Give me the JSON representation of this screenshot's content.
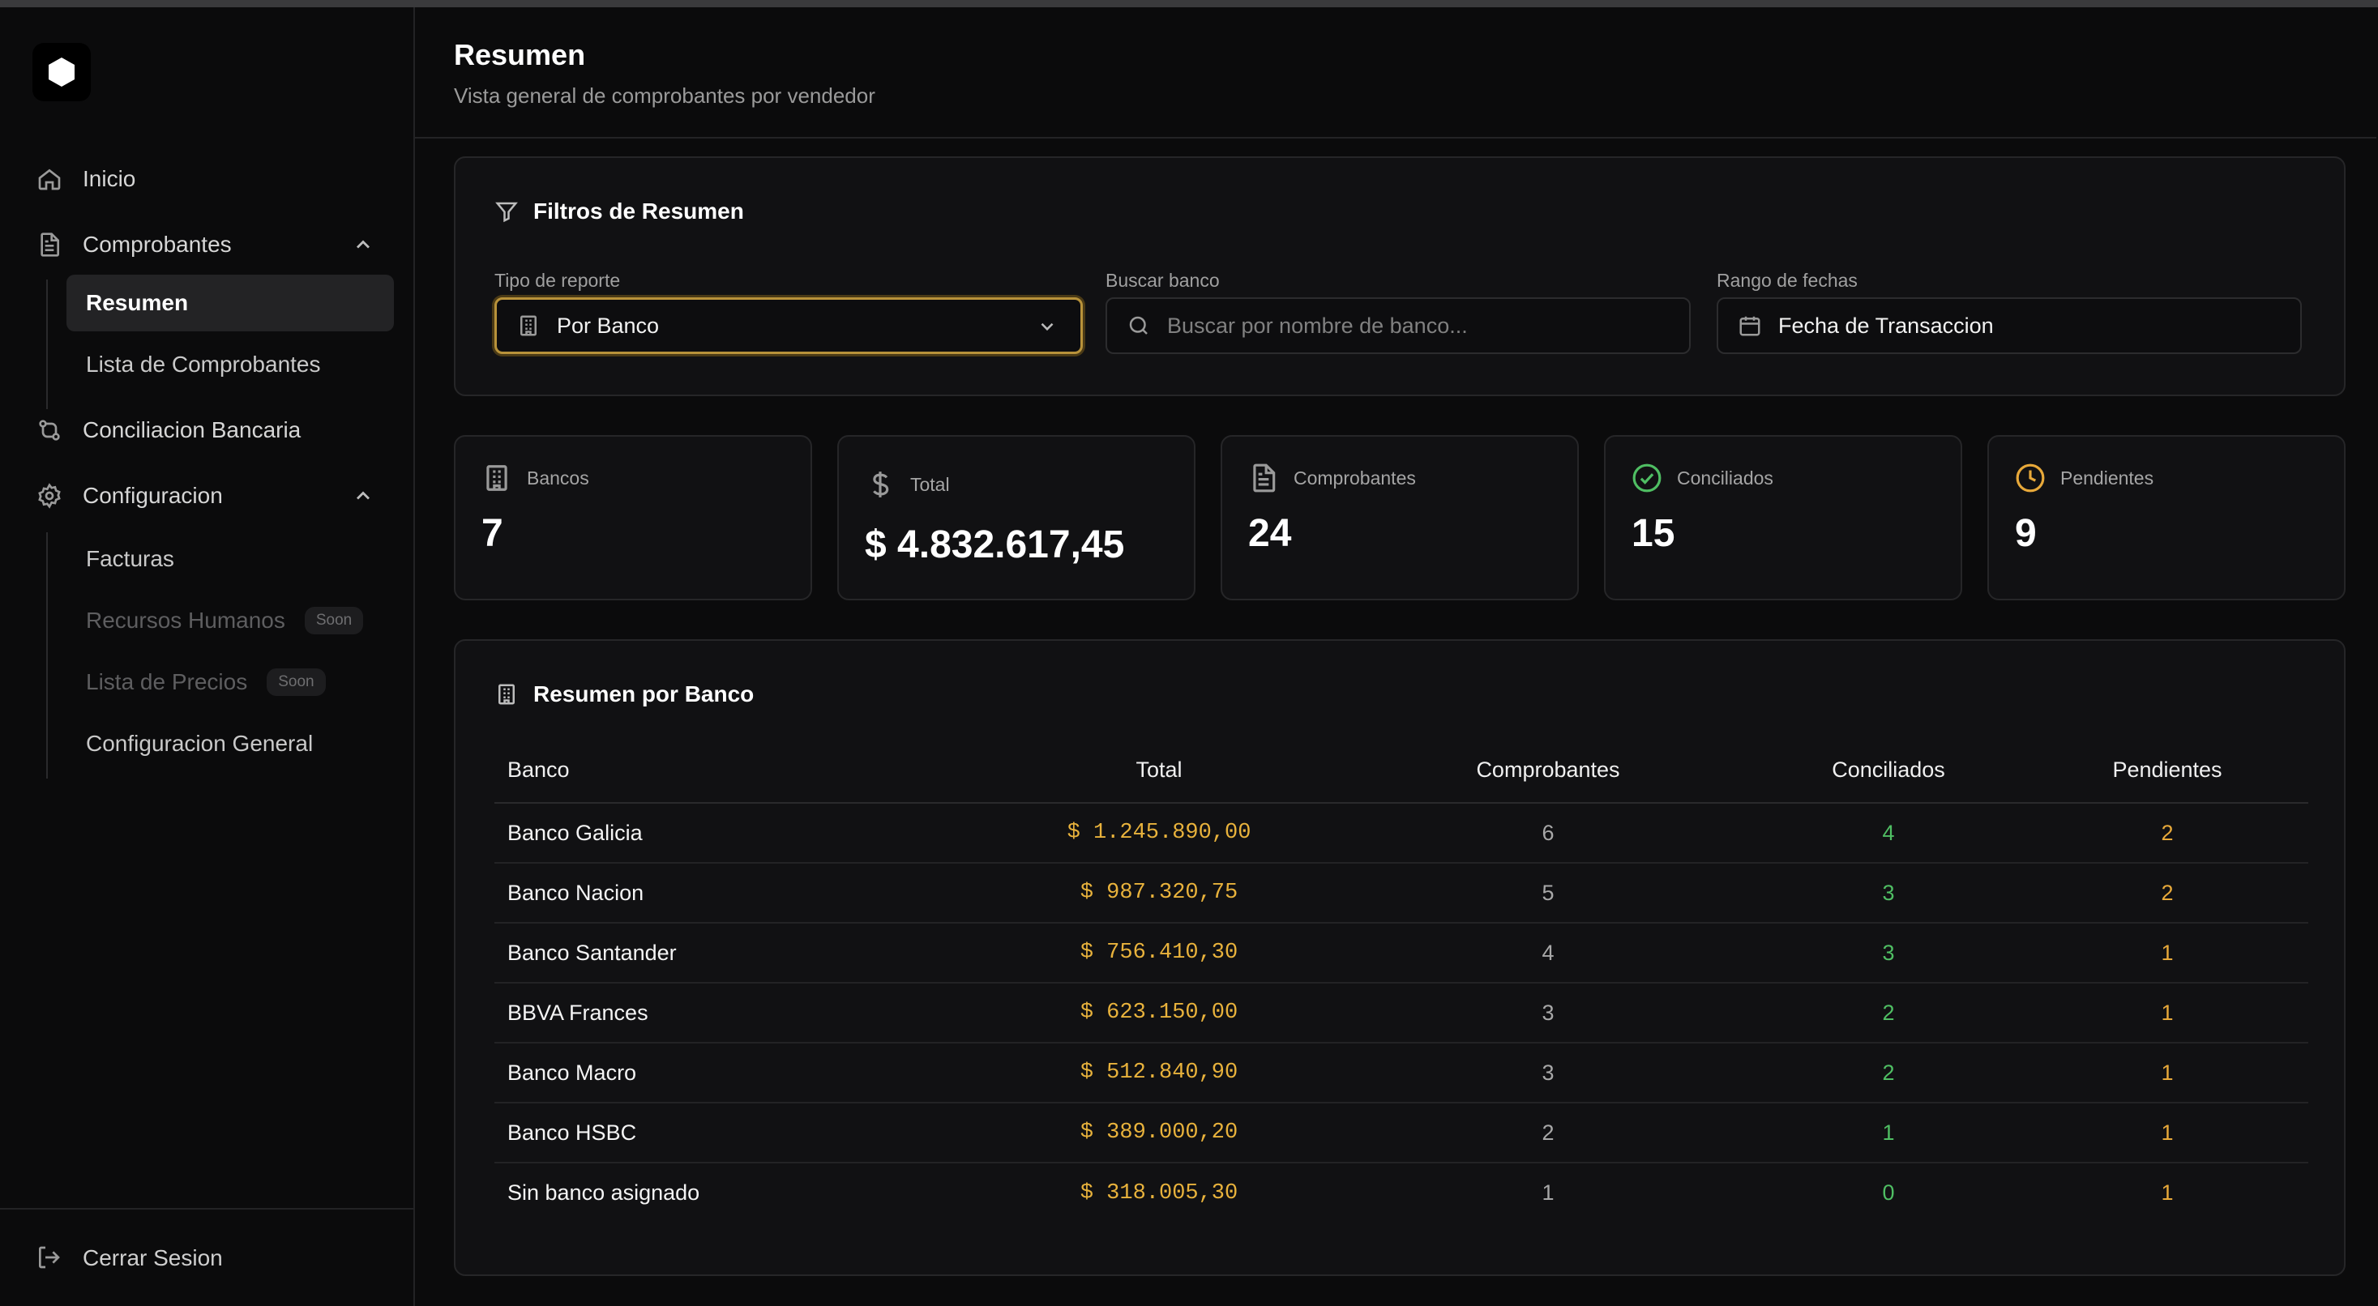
{
  "colors": {
    "accent": "#e8b23c",
    "success": "#4fbe63",
    "warning": "#e8a93a",
    "background": "#0b0b0c"
  },
  "sidebar": {
    "logo_icon": "hexagon-logo-icon",
    "items": [
      {
        "label": "Inicio",
        "icon": "home-icon"
      },
      {
        "label": "Comprobantes",
        "icon": "document-icon",
        "expanded": true,
        "children": [
          {
            "label": "Resumen",
            "active": true
          },
          {
            "label": "Lista de Comprobantes"
          }
        ]
      },
      {
        "label": "Conciliacion Bancaria",
        "icon": "git-compare-icon"
      },
      {
        "label": "Configuracion",
        "icon": "gear-icon",
        "expanded": true,
        "children": [
          {
            "label": "Facturas"
          },
          {
            "label": "Recursos Humanos",
            "badge": "Soon",
            "disabled": true
          },
          {
            "label": "Lista de Precios",
            "badge": "Soon",
            "disabled": true
          },
          {
            "label": "Configuracion General"
          }
        ]
      }
    ],
    "logout_label": "Cerrar Sesion"
  },
  "header": {
    "title": "Resumen",
    "subtitle": "Vista general de comprobantes por vendedor"
  },
  "filters": {
    "title": "Filtros de Resumen",
    "report_type": {
      "label": "Tipo de reporte",
      "value": "Por Banco"
    },
    "bank_search": {
      "label": "Buscar banco",
      "placeholder": "Buscar por nombre de banco..."
    },
    "date_range": {
      "label": "Rango de fechas",
      "value": "Fecha de Transaccion"
    }
  },
  "stats": [
    {
      "label": "Bancos",
      "value": "7",
      "icon": "building-icon"
    },
    {
      "label": "Total",
      "value": "$ 4.832.617,45",
      "icon": "dollar-icon"
    },
    {
      "label": "Comprobantes",
      "value": "24",
      "icon": "document-icon"
    },
    {
      "label": "Conciliados",
      "value": "15",
      "icon": "check-circle-icon"
    },
    {
      "label": "Pendientes",
      "value": "9",
      "icon": "clock-icon"
    }
  ],
  "table": {
    "title": "Resumen por Banco",
    "columns": [
      "Banco",
      "Total",
      "Comprobantes",
      "Conciliados",
      "Pendientes"
    ],
    "rows": [
      {
        "bank": "Banco Galicia",
        "total": "$ 1.245.890,00",
        "comprobantes": "6",
        "conciliados": "4",
        "pendientes": "2"
      },
      {
        "bank": "Banco Nacion",
        "total": "$ 987.320,75",
        "comprobantes": "5",
        "conciliados": "3",
        "pendientes": "2"
      },
      {
        "bank": "Banco Santander",
        "total": "$ 756.410,30",
        "comprobantes": "4",
        "conciliados": "3",
        "pendientes": "1"
      },
      {
        "bank": "BBVA Frances",
        "total": "$ 623.150,00",
        "comprobantes": "3",
        "conciliados": "2",
        "pendientes": "1"
      },
      {
        "bank": "Banco Macro",
        "total": "$ 512.840,90",
        "comprobantes": "3",
        "conciliados": "2",
        "pendientes": "1"
      },
      {
        "bank": "Banco HSBC",
        "total": "$ 389.000,20",
        "comprobantes": "2",
        "conciliados": "1",
        "pendientes": "1"
      },
      {
        "bank": "Sin banco asignado",
        "total": "$ 318.005,30",
        "comprobantes": "1",
        "conciliados": "0",
        "pendientes": "1"
      }
    ]
  }
}
